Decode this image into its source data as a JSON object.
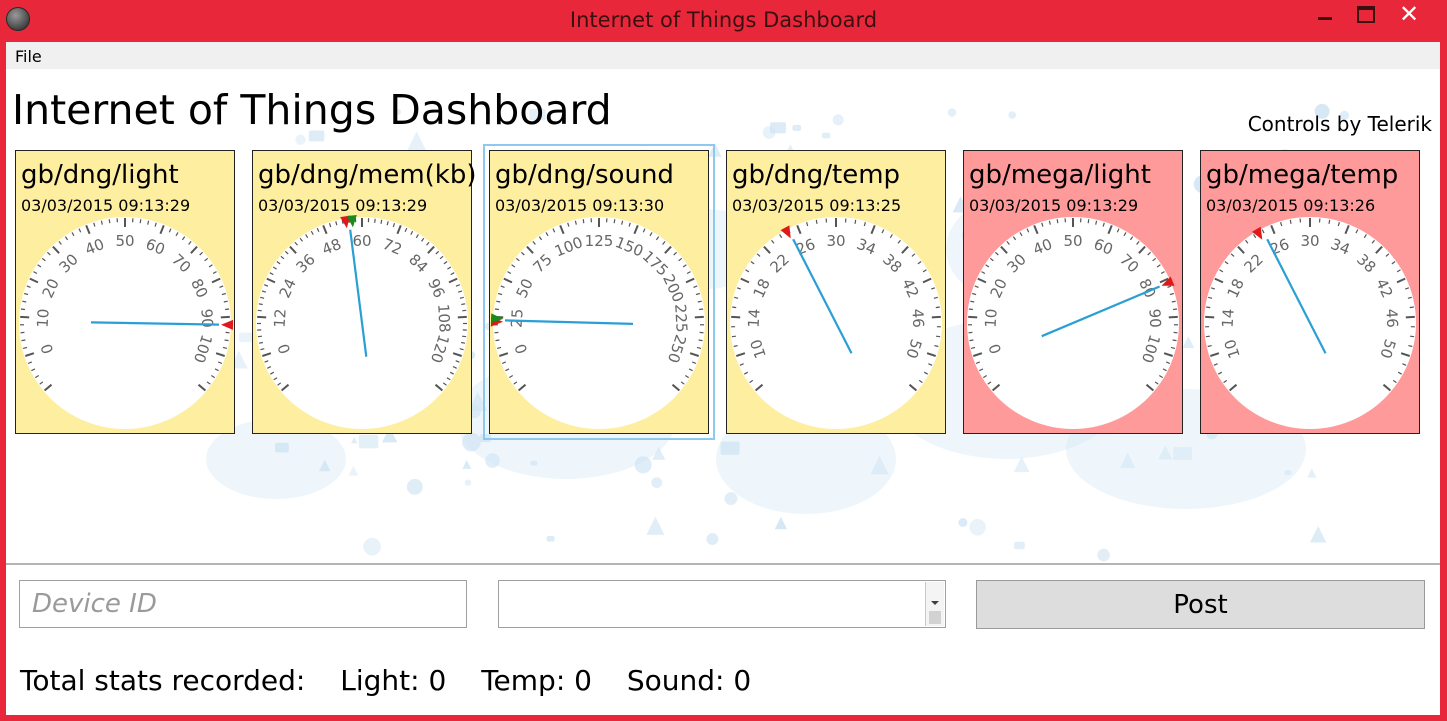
{
  "window": {
    "title": "Internet of Things Dashboard",
    "close_symbol": "✕",
    "titlebar_color": "#e8283a"
  },
  "menu": {
    "file_label": "File"
  },
  "header": {
    "title": "Internet of Things Dashboard",
    "credit": "Controls by Telerik"
  },
  "panels": [
    {
      "title": "gb/dng/light",
      "timestamp": "03/03/2015 09:13:29",
      "status": "normal",
      "bg": "#fdeea0",
      "scale": {
        "min": -10,
        "max": 110,
        "major_step": 10,
        "minor_per_major": 5,
        "label_min": 0,
        "label_max": 100
      },
      "value": 92,
      "markers": [
        {
          "value": 92,
          "color": "#e01818"
        }
      ]
    },
    {
      "title": "gb/dng/mem(kb)",
      "timestamp": "03/03/2015 09:13:29",
      "status": "normal",
      "bg": "#fdeea0",
      "scale": {
        "min": -12,
        "max": 132,
        "major_step": 12,
        "minor_per_major": 6,
        "label_min": 0,
        "label_max": 120
      },
      "value": 56,
      "markers": [
        {
          "value": 55,
          "color": "#e01818"
        },
        {
          "value": 57,
          "color": "#1a8a1a"
        }
      ]
    },
    {
      "title": "gb/dng/sound",
      "timestamp": "03/03/2015 09:13:30",
      "status": "normal",
      "bg": "#fdeea0",
      "selected": true,
      "scale": {
        "min": -25,
        "max": 275,
        "major_step": 25,
        "minor_per_major": 5,
        "label_min": 0,
        "label_max": 250
      },
      "value": 23,
      "markers": [
        {
          "value": 22,
          "color": "#e01818"
        },
        {
          "value": 24,
          "color": "#1a8a1a"
        }
      ]
    },
    {
      "title": "gb/dng/temp",
      "timestamp": "03/03/2015 09:13:25",
      "status": "normal",
      "bg": "#fdeea0",
      "scale": {
        "min": 6,
        "max": 54,
        "major_step": 4,
        "minor_per_major": 4,
        "label_min": 10,
        "label_max": 50
      },
      "value": 25,
      "markers": [
        {
          "value": 24.8,
          "color": "#e01818"
        }
      ]
    },
    {
      "title": "gb/mega/light",
      "timestamp": "03/03/2015 09:13:29",
      "status": "alert",
      "bg": "#ff9a9a",
      "scale": {
        "min": -10,
        "max": 110,
        "major_step": 10,
        "minor_per_major": 5,
        "label_min": 0,
        "label_max": 100
      },
      "value": 81,
      "markers": [
        {
          "value": 81,
          "color": "#e01818"
        }
      ]
    },
    {
      "title": "gb/mega/temp",
      "timestamp": "03/03/2015 09:13:26",
      "status": "alert",
      "bg": "#ff9a9a",
      "scale": {
        "min": 6,
        "max": 54,
        "major_step": 4,
        "minor_per_major": 4,
        "label_min": 10,
        "label_max": 50
      },
      "value": 25,
      "markers": [
        {
          "value": 24.5,
          "color": "#e01818"
        }
      ]
    }
  ],
  "form": {
    "device_placeholder": "Device ID",
    "device_value": "",
    "combo_value": "",
    "post_label": "Post"
  },
  "stats": {
    "label": "Total stats recorded:",
    "light": "Light: 0",
    "temp": "Temp: 0",
    "sound": "Sound: 0"
  },
  "colors": {
    "needle": "#2a9fd6",
    "gauge_face": "#ffffff",
    "tick": "#555555",
    "label": "#666666",
    "art": "#cfe4f3"
  }
}
